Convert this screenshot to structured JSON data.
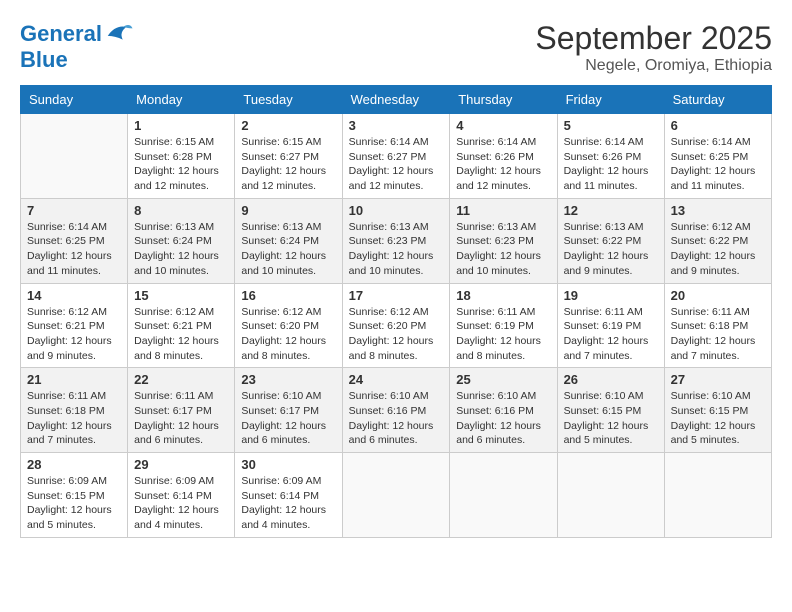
{
  "header": {
    "logo_line1": "General",
    "logo_line2": "Blue",
    "month": "September 2025",
    "location": "Negele, Oromiya, Ethiopia"
  },
  "weekdays": [
    "Sunday",
    "Monday",
    "Tuesday",
    "Wednesday",
    "Thursday",
    "Friday",
    "Saturday"
  ],
  "weeks": [
    [
      {
        "day": "",
        "sunrise": "",
        "sunset": "",
        "daylight": ""
      },
      {
        "day": "1",
        "sunrise": "Sunrise: 6:15 AM",
        "sunset": "Sunset: 6:28 PM",
        "daylight": "Daylight: 12 hours and 12 minutes."
      },
      {
        "day": "2",
        "sunrise": "Sunrise: 6:15 AM",
        "sunset": "Sunset: 6:27 PM",
        "daylight": "Daylight: 12 hours and 12 minutes."
      },
      {
        "day": "3",
        "sunrise": "Sunrise: 6:14 AM",
        "sunset": "Sunset: 6:27 PM",
        "daylight": "Daylight: 12 hours and 12 minutes."
      },
      {
        "day": "4",
        "sunrise": "Sunrise: 6:14 AM",
        "sunset": "Sunset: 6:26 PM",
        "daylight": "Daylight: 12 hours and 12 minutes."
      },
      {
        "day": "5",
        "sunrise": "Sunrise: 6:14 AM",
        "sunset": "Sunset: 6:26 PM",
        "daylight": "Daylight: 12 hours and 11 minutes."
      },
      {
        "day": "6",
        "sunrise": "Sunrise: 6:14 AM",
        "sunset": "Sunset: 6:25 PM",
        "daylight": "Daylight: 12 hours and 11 minutes."
      }
    ],
    [
      {
        "day": "7",
        "sunrise": "Sunrise: 6:14 AM",
        "sunset": "Sunset: 6:25 PM",
        "daylight": "Daylight: 12 hours and 11 minutes."
      },
      {
        "day": "8",
        "sunrise": "Sunrise: 6:13 AM",
        "sunset": "Sunset: 6:24 PM",
        "daylight": "Daylight: 12 hours and 10 minutes."
      },
      {
        "day": "9",
        "sunrise": "Sunrise: 6:13 AM",
        "sunset": "Sunset: 6:24 PM",
        "daylight": "Daylight: 12 hours and 10 minutes."
      },
      {
        "day": "10",
        "sunrise": "Sunrise: 6:13 AM",
        "sunset": "Sunset: 6:23 PM",
        "daylight": "Daylight: 12 hours and 10 minutes."
      },
      {
        "day": "11",
        "sunrise": "Sunrise: 6:13 AM",
        "sunset": "Sunset: 6:23 PM",
        "daylight": "Daylight: 12 hours and 10 minutes."
      },
      {
        "day": "12",
        "sunrise": "Sunrise: 6:13 AM",
        "sunset": "Sunset: 6:22 PM",
        "daylight": "Daylight: 12 hours and 9 minutes."
      },
      {
        "day": "13",
        "sunrise": "Sunrise: 6:12 AM",
        "sunset": "Sunset: 6:22 PM",
        "daylight": "Daylight: 12 hours and 9 minutes."
      }
    ],
    [
      {
        "day": "14",
        "sunrise": "Sunrise: 6:12 AM",
        "sunset": "Sunset: 6:21 PM",
        "daylight": "Daylight: 12 hours and 9 minutes."
      },
      {
        "day": "15",
        "sunrise": "Sunrise: 6:12 AM",
        "sunset": "Sunset: 6:21 PM",
        "daylight": "Daylight: 12 hours and 8 minutes."
      },
      {
        "day": "16",
        "sunrise": "Sunrise: 6:12 AM",
        "sunset": "Sunset: 6:20 PM",
        "daylight": "Daylight: 12 hours and 8 minutes."
      },
      {
        "day": "17",
        "sunrise": "Sunrise: 6:12 AM",
        "sunset": "Sunset: 6:20 PM",
        "daylight": "Daylight: 12 hours and 8 minutes."
      },
      {
        "day": "18",
        "sunrise": "Sunrise: 6:11 AM",
        "sunset": "Sunset: 6:19 PM",
        "daylight": "Daylight: 12 hours and 8 minutes."
      },
      {
        "day": "19",
        "sunrise": "Sunrise: 6:11 AM",
        "sunset": "Sunset: 6:19 PM",
        "daylight": "Daylight: 12 hours and 7 minutes."
      },
      {
        "day": "20",
        "sunrise": "Sunrise: 6:11 AM",
        "sunset": "Sunset: 6:18 PM",
        "daylight": "Daylight: 12 hours and 7 minutes."
      }
    ],
    [
      {
        "day": "21",
        "sunrise": "Sunrise: 6:11 AM",
        "sunset": "Sunset: 6:18 PM",
        "daylight": "Daylight: 12 hours and 7 minutes."
      },
      {
        "day": "22",
        "sunrise": "Sunrise: 6:11 AM",
        "sunset": "Sunset: 6:17 PM",
        "daylight": "Daylight: 12 hours and 6 minutes."
      },
      {
        "day": "23",
        "sunrise": "Sunrise: 6:10 AM",
        "sunset": "Sunset: 6:17 PM",
        "daylight": "Daylight: 12 hours and 6 minutes."
      },
      {
        "day": "24",
        "sunrise": "Sunrise: 6:10 AM",
        "sunset": "Sunset: 6:16 PM",
        "daylight": "Daylight: 12 hours and 6 minutes."
      },
      {
        "day": "25",
        "sunrise": "Sunrise: 6:10 AM",
        "sunset": "Sunset: 6:16 PM",
        "daylight": "Daylight: 12 hours and 6 minutes."
      },
      {
        "day": "26",
        "sunrise": "Sunrise: 6:10 AM",
        "sunset": "Sunset: 6:15 PM",
        "daylight": "Daylight: 12 hours and 5 minutes."
      },
      {
        "day": "27",
        "sunrise": "Sunrise: 6:10 AM",
        "sunset": "Sunset: 6:15 PM",
        "daylight": "Daylight: 12 hours and 5 minutes."
      }
    ],
    [
      {
        "day": "28",
        "sunrise": "Sunrise: 6:09 AM",
        "sunset": "Sunset: 6:15 PM",
        "daylight": "Daylight: 12 hours and 5 minutes."
      },
      {
        "day": "29",
        "sunrise": "Sunrise: 6:09 AM",
        "sunset": "Sunset: 6:14 PM",
        "daylight": "Daylight: 12 hours and 4 minutes."
      },
      {
        "day": "30",
        "sunrise": "Sunrise: 6:09 AM",
        "sunset": "Sunset: 6:14 PM",
        "daylight": "Daylight: 12 hours and 4 minutes."
      },
      {
        "day": "",
        "sunrise": "",
        "sunset": "",
        "daylight": ""
      },
      {
        "day": "",
        "sunrise": "",
        "sunset": "",
        "daylight": ""
      },
      {
        "day": "",
        "sunrise": "",
        "sunset": "",
        "daylight": ""
      },
      {
        "day": "",
        "sunrise": "",
        "sunset": "",
        "daylight": ""
      }
    ]
  ]
}
